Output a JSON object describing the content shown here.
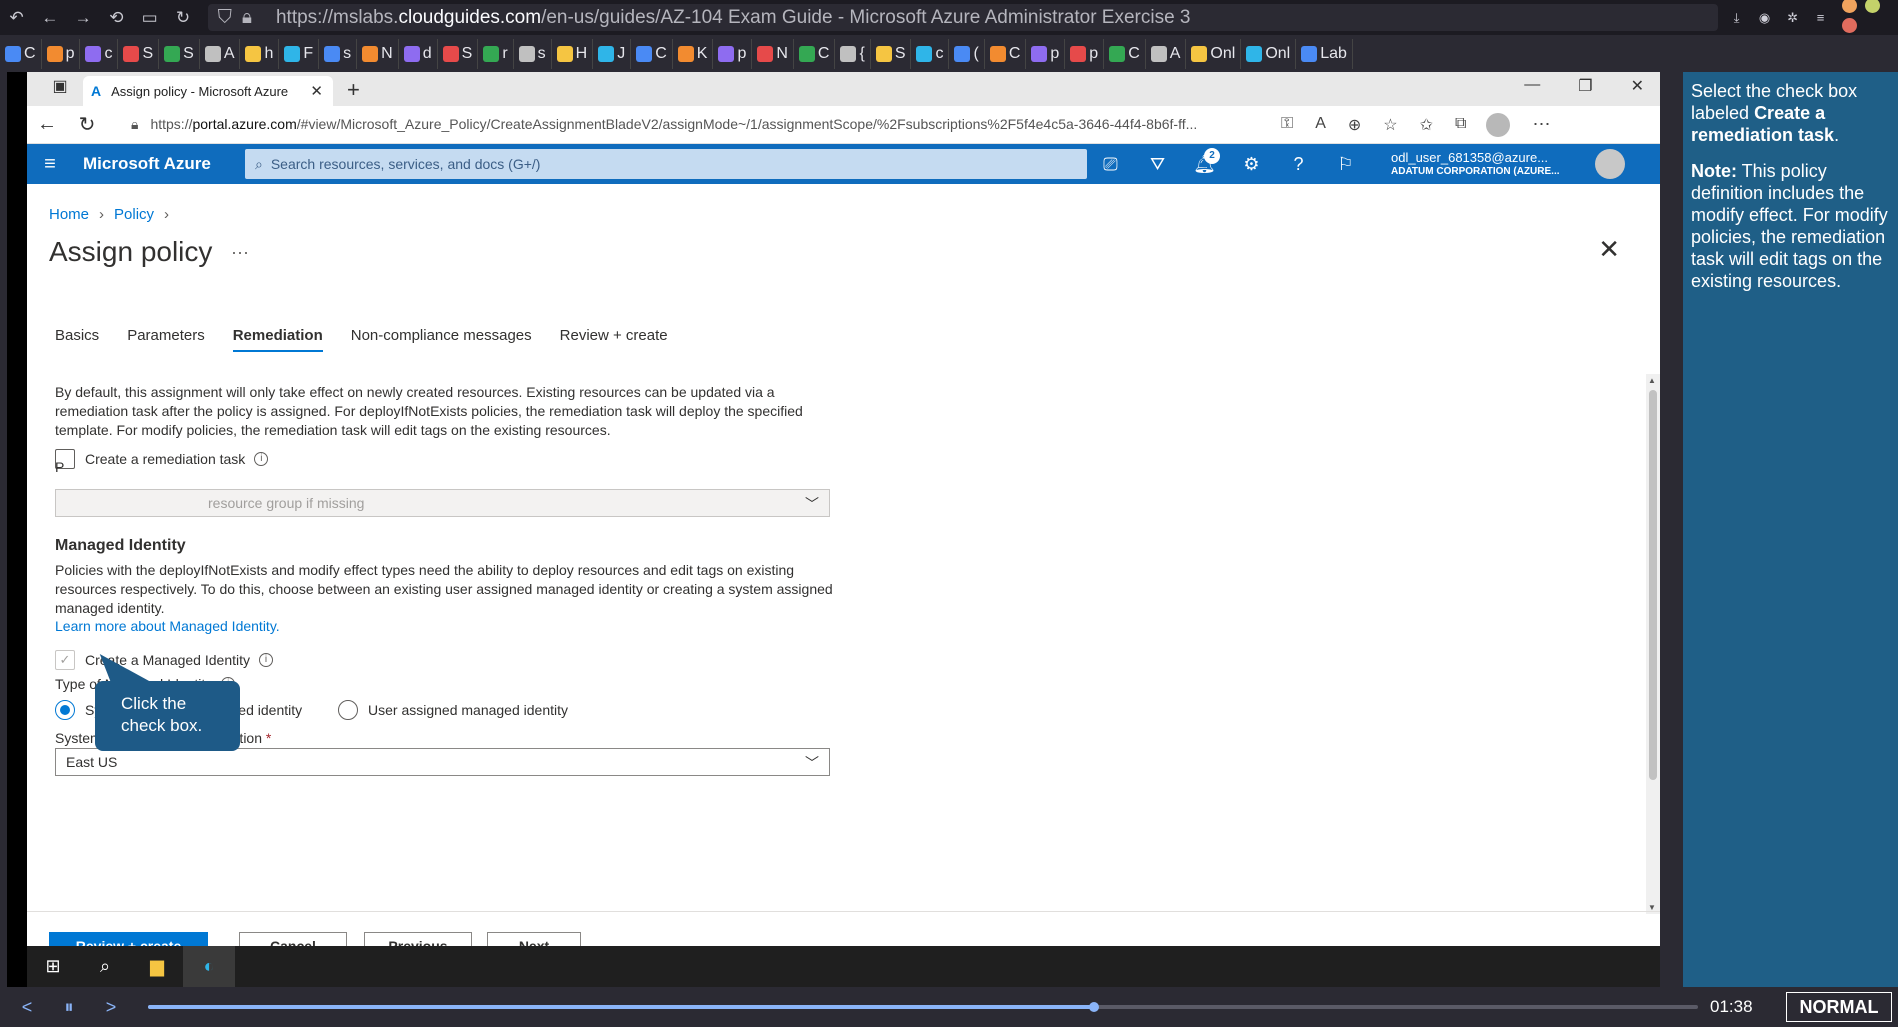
{
  "firefox": {
    "url_prefix": "https://mslabs.",
    "url_host": "cloudguides.com",
    "url_rest": "/en-us/guides/AZ-104 Exam Guide - Microsoft Azure Administrator Exercise 3",
    "bookmarks": [
      "C",
      "p",
      "c",
      "S",
      "S",
      "A",
      "h",
      "F",
      "s",
      "N",
      "d",
      "S",
      "r",
      "s",
      "H",
      "J",
      "C",
      "K",
      "p",
      "N",
      "C",
      "{",
      "S",
      "c",
      "(",
      "C",
      "p",
      "p",
      "C",
      "A",
      "Onl",
      "Onl",
      "Lab"
    ]
  },
  "edge": {
    "tab_title": "Assign policy - Microsoft Azure",
    "url_prefix": "https://",
    "url_domain": "portal.azure.com",
    "url_rest": "/#view/Microsoft_Azure_Policy/CreateAssignmentBladeV2/assignMode~/1/assignmentScope/%2Fsubscriptions%2F5f4e4c5a-3646-44f4-8b6f-ff..."
  },
  "azure": {
    "brand": "Microsoft Azure",
    "search_placeholder": "Search resources, services, and docs (G+/)",
    "notification_count": "2",
    "user_name": "odl_user_681358@azure...",
    "user_org": "ADATUM CORPORATION (AZURE..."
  },
  "page": {
    "breadcrumb": [
      "Home",
      "Policy"
    ],
    "title": "Assign policy",
    "tabs": [
      "Basics",
      "Parameters",
      "Remediation",
      "Non-compliance messages",
      "Review + create"
    ],
    "active_tab": "Remediation",
    "description": "By default, this assignment will only take effect on newly created resources. Existing resources can be updated via a remediation task after the policy is assigned. For deployIfNotExists policies, the remediation task will deploy the specified template. For modify policies, the remediation task will edit tags on the existing resources.",
    "create_remediation_label": "Create a remediation task",
    "policy_label_partial": "P",
    "policy_dropdown_value": "resource group if missing",
    "managed_identity_heading": "Managed Identity",
    "managed_identity_desc": "Policies with the deployIfNotExists and modify effect types need the ability to deploy resources and edit tags on existing resources respectively. To do this, choose between an existing user assigned managed identity or creating a system assigned managed identity.",
    "managed_identity_link": "Learn more about Managed Identity.",
    "create_mi_label": "Create a Managed Identity",
    "type_mi_label": "Type of Managed Identity",
    "radio_system": "System assigned managed identity",
    "radio_user": "User assigned managed identity",
    "location_label": "System assigned identity location",
    "location_value": "East US",
    "buttons": {
      "review_create": "Review + create",
      "cancel": "Cancel",
      "previous": "Previous",
      "next": "Next"
    }
  },
  "callout": {
    "line1": "Click the",
    "line2": "check box."
  },
  "guide": {
    "p1_pre": "Select the check box labeled ",
    "p1_bold": "Create a remediation task",
    "p1_post": ".",
    "note_label": "Note:",
    "note_text": " This policy definition includes the modify effect. For modify policies, the remediation task will edit tags on the existing resources."
  },
  "player": {
    "time": "01:38",
    "mode": "NORMAL",
    "progress_fraction": 0.61
  },
  "colors": {
    "azure_blue": "#0f6cbd",
    "guide_bg": "#1f5f87",
    "callout_bg": "#1e5a87",
    "primary_button": "#0078d4"
  }
}
